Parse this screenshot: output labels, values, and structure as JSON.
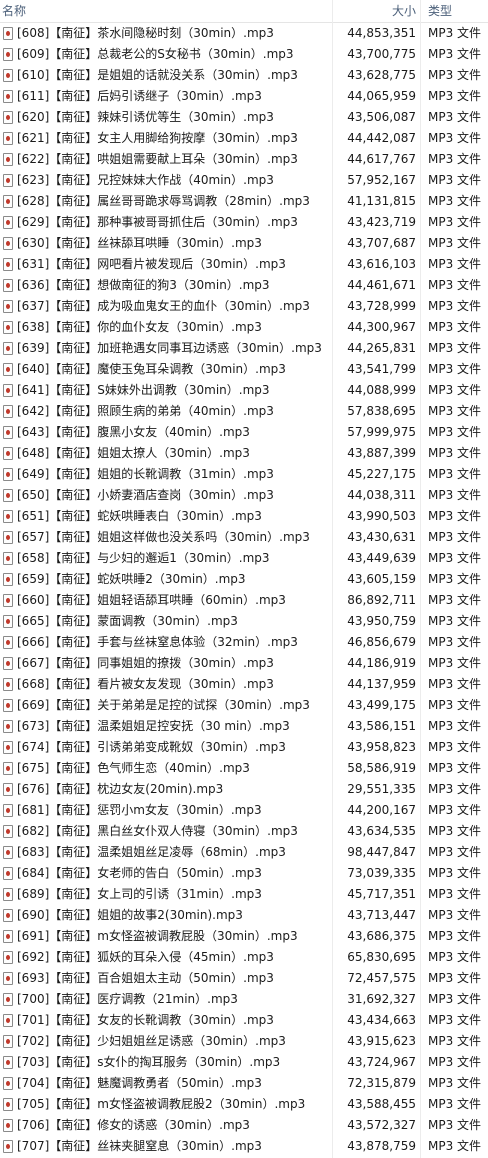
{
  "columns": {
    "name": "名称",
    "size": "大小",
    "type": "类型"
  },
  "files": [
    {
      "name": "[608]【南征】茶水间隐秘时刻（30min）.mp3",
      "size": "44,853,351",
      "type": "MP3 文件"
    },
    {
      "name": "[609]【南征】总裁老公的S女秘书（30min）.mp3",
      "size": "43,700,775",
      "type": "MP3 文件"
    },
    {
      "name": "[610]【南征】是姐姐的话就没关系（30min）.mp3",
      "size": "43,628,775",
      "type": "MP3 文件"
    },
    {
      "name": "[611]【南征】后妈引诱继子（30min）.mp3",
      "size": "44,065,959",
      "type": "MP3 文件"
    },
    {
      "name": "[620]【南征】辣妹引诱优等生（30min）.mp3",
      "size": "43,506,087",
      "type": "MP3 文件"
    },
    {
      "name": "[621]【南征】女主人用脚给狗按摩（30min）.mp3",
      "size": "44,442,087",
      "type": "MP3 文件"
    },
    {
      "name": "[622]【南征】哄姐姐需要献上耳朵（30min）.mp3",
      "size": "44,617,767",
      "type": "MP3 文件"
    },
    {
      "name": "[623]【南征】兄控妹妹大作战（40min）.mp3",
      "size": "57,952,167",
      "type": "MP3 文件"
    },
    {
      "name": "[628]【南征】属丝哥哥跪求辱骂调教（28min）.mp3",
      "size": "41,131,815",
      "type": "MP3 文件"
    },
    {
      "name": "[629]【南征】那种事被哥哥抓住后（30min）.mp3",
      "size": "43,423,719",
      "type": "MP3 文件"
    },
    {
      "name": "[630]【南征】丝袜舔耳哄睡（30min）.mp3",
      "size": "43,707,687",
      "type": "MP3 文件"
    },
    {
      "name": "[631]【南征】网吧看片被发现后（30min）.mp3",
      "size": "43,616,103",
      "type": "MP3 文件"
    },
    {
      "name": "[636]【南征】想做南征的狗3（30min）.mp3",
      "size": "44,461,671",
      "type": "MP3 文件"
    },
    {
      "name": "[637]【南征】成为吸血鬼女王的血仆（30min）.mp3",
      "size": "43,728,999",
      "type": "MP3 文件"
    },
    {
      "name": "[638]【南征】你的血仆女友（30min）.mp3",
      "size": "44,300,967",
      "type": "MP3 文件"
    },
    {
      "name": "[639]【南征】加班艳遇女同事耳边诱惑（30min）.mp3",
      "size": "44,265,831",
      "type": "MP3 文件"
    },
    {
      "name": "[640]【南征】魔使玉兔耳朵调教（30min）.mp3",
      "size": "43,541,799",
      "type": "MP3 文件"
    },
    {
      "name": "[641]【南征】S妹妹外出调教（30min）.mp3",
      "size": "44,088,999",
      "type": "MP3 文件"
    },
    {
      "name": "[642]【南征】照顾生病的弟弟（40min）.mp3",
      "size": "57,838,695",
      "type": "MP3 文件"
    },
    {
      "name": "[643]【南征】腹黑小女友（40min）.mp3",
      "size": "57,999,975",
      "type": "MP3 文件"
    },
    {
      "name": "[648]【南征】姐姐太撩人（30min）.mp3",
      "size": "43,887,399",
      "type": "MP3 文件"
    },
    {
      "name": "[649]【南征】姐姐的长靴调教（31min）.mp3",
      "size": "45,227,175",
      "type": "MP3 文件"
    },
    {
      "name": "[650]【南征】小娇妻酒店查岗（30min）.mp3",
      "size": "44,038,311",
      "type": "MP3 文件"
    },
    {
      "name": "[651]【南征】蛇妖哄睡表白（30min）.mp3",
      "size": "43,990,503",
      "type": "MP3 文件"
    },
    {
      "name": "[657]【南征】姐姐这样做也没关系吗（30min）.mp3",
      "size": "43,430,631",
      "type": "MP3 文件"
    },
    {
      "name": "[658]【南征】与少妇的邂逅1（30min）.mp3",
      "size": "43,449,639",
      "type": "MP3 文件"
    },
    {
      "name": "[659]【南征】蛇妖哄睡2（30min）.mp3",
      "size": "43,605,159",
      "type": "MP3 文件"
    },
    {
      "name": "[660]【南征】姐姐轻语舔耳哄睡（60min）.mp3",
      "size": "86,892,711",
      "type": "MP3 文件"
    },
    {
      "name": "[665]【南征】蒙面调教（30min）.mp3",
      "size": "43,950,759",
      "type": "MP3 文件"
    },
    {
      "name": "[666]【南征】手套与丝袜窒息体验（32min）.mp3",
      "size": "46,856,679",
      "type": "MP3 文件"
    },
    {
      "name": "[667]【南征】同事姐姐的撩拨（30min）.mp3",
      "size": "44,186,919",
      "type": "MP3 文件"
    },
    {
      "name": "[668]【南征】看片被女友发现（30min）.mp3",
      "size": "44,137,959",
      "type": "MP3 文件"
    },
    {
      "name": "[669]【南征】关于弟弟是足控的试探（30min）.mp3",
      "size": "43,499,175",
      "type": "MP3 文件"
    },
    {
      "name": "[673]【南征】温柔姐姐足控安抚（30 min）.mp3",
      "size": "43,586,151",
      "type": "MP3 文件"
    },
    {
      "name": "[674]【南征】引诱弟弟变成靴奴（30min）.mp3",
      "size": "43,958,823",
      "type": "MP3 文件"
    },
    {
      "name": "[675]【南征】色气师生恋（40min）.mp3",
      "size": "58,586,919",
      "type": "MP3 文件"
    },
    {
      "name": "[676]【南征】枕边女友(20min).mp3",
      "size": "29,551,335",
      "type": "MP3 文件"
    },
    {
      "name": "[681]【南征】惩罚小m女友（30min）.mp3",
      "size": "44,200,167",
      "type": "MP3 文件"
    },
    {
      "name": "[682]【南征】黑白丝女仆双人侍寝（30min）.mp3",
      "size": "43,634,535",
      "type": "MP3 文件"
    },
    {
      "name": "[683]【南征】温柔姐姐丝足凌辱（68min）.mp3",
      "size": "98,447,847",
      "type": "MP3 文件"
    },
    {
      "name": "[684]【南征】女老师的告白（50min）.mp3",
      "size": "73,039,335",
      "type": "MP3 文件"
    },
    {
      "name": "[689]【南征】女上司的引诱（31min）.mp3",
      "size": "45,717,351",
      "type": "MP3 文件"
    },
    {
      "name": "[690]【南征】姐姐的故事2(30min).mp3",
      "size": "43,713,447",
      "type": "MP3 文件"
    },
    {
      "name": "[691]【南征】m女怪盗被调教屁股（30min）.mp3",
      "size": "43,686,375",
      "type": "MP3 文件"
    },
    {
      "name": "[692]【南征】狐妖的耳朵入侵（45min）.mp3",
      "size": "65,830,695",
      "type": "MP3 文件"
    },
    {
      "name": "[693]【南征】百合姐姐太主动（50min）.mp3",
      "size": "72,457,575",
      "type": "MP3 文件"
    },
    {
      "name": "[700]【南征】医疗调教（21min）.mp3",
      "size": "31,692,327",
      "type": "MP3 文件"
    },
    {
      "name": "[701]【南征】女友的长靴调教（30min）.mp3",
      "size": "43,434,663",
      "type": "MP3 文件"
    },
    {
      "name": "[702]【南征】少妇姐姐丝足诱惑（30min）.mp3",
      "size": "43,915,623",
      "type": "MP3 文件"
    },
    {
      "name": "[703]【南征】s女仆的掏耳服务（30min）.mp3",
      "size": "43,724,967",
      "type": "MP3 文件"
    },
    {
      "name": "[704]【南征】魅魔调教勇者（50min）.mp3",
      "size": "72,315,879",
      "type": "MP3 文件"
    },
    {
      "name": "[705]【南征】m女怪盗被调教屁股2（30min）.mp3",
      "size": "43,588,455",
      "type": "MP3 文件"
    },
    {
      "name": "[706]【南征】修女的诱惑（30min）.mp3",
      "size": "43,572,327",
      "type": "MP3 文件"
    },
    {
      "name": "[707]【南征】丝袜夹腿窒息（30min）.mp3",
      "size": "43,878,759",
      "type": "MP3 文件"
    }
  ]
}
